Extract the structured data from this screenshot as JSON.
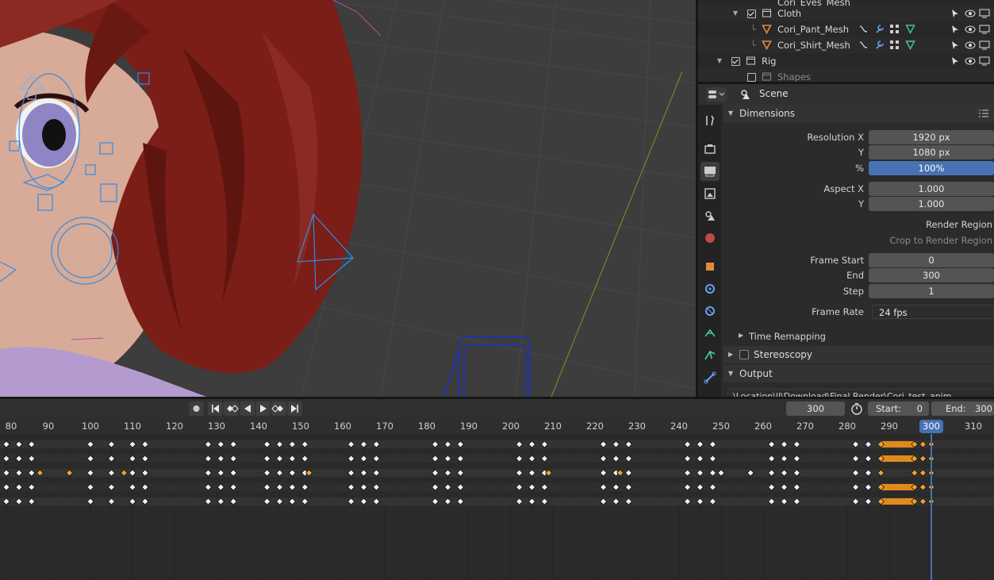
{
  "outliner": {
    "rows": [
      {
        "label": "Cori_Eyes_Mesh",
        "type": "mesh"
      },
      {
        "label": "Cloth",
        "type": "collection"
      },
      {
        "label": "Cori_Pant_Mesh",
        "type": "mesh"
      },
      {
        "label": "Cori_Shirt_Mesh",
        "type": "mesh"
      },
      {
        "label": "Rig",
        "type": "collection"
      },
      {
        "label": "Shapes",
        "type": "collection"
      }
    ]
  },
  "properties": {
    "context": "Scene",
    "dimensions": {
      "title": "Dimensions",
      "resolution_x_label": "Resolution X",
      "resolution_x": "1920 px",
      "resolution_y_label": "Y",
      "resolution_y": "1080 px",
      "percent_label": "%",
      "percent": "100%",
      "aspect_x_label": "Aspect X",
      "aspect_x": "1.000",
      "aspect_y_label": "Y",
      "aspect_y": "1.000",
      "render_region": "Render Region",
      "crop_region": "Crop to Render Region",
      "frame_start_label": "Frame Start",
      "frame_start": "0",
      "frame_end_label": "End",
      "frame_end": "300",
      "frame_step_label": "Step",
      "frame_step": "1",
      "frame_rate_label": "Frame Rate",
      "frame_rate": "24 fps",
      "time_remapping": "Time Remapping"
    },
    "stereoscopy": "Stereoscopy",
    "output": "Output",
    "output_path_hint": "\\Location\\ll\\Download\\Final Render\\Cori_test_anim"
  },
  "timeline": {
    "current_frame": "300",
    "start_label": "Start:",
    "start": "0",
    "end_label": "End:",
    "end": "300",
    "ruler_labels": [
      "80",
      "90",
      "100",
      "110",
      "120",
      "130",
      "140",
      "150",
      "160",
      "170",
      "180",
      "190",
      "200",
      "210",
      "220",
      "230",
      "240",
      "250",
      "260",
      "270",
      "280",
      "290",
      "300",
      "310"
    ]
  },
  "colors": {
    "accent_blue": "#4772b3",
    "keyframe_selected": "#f0a030",
    "hair": "#7a1e17",
    "rig_blue": "#2e8ee6"
  }
}
